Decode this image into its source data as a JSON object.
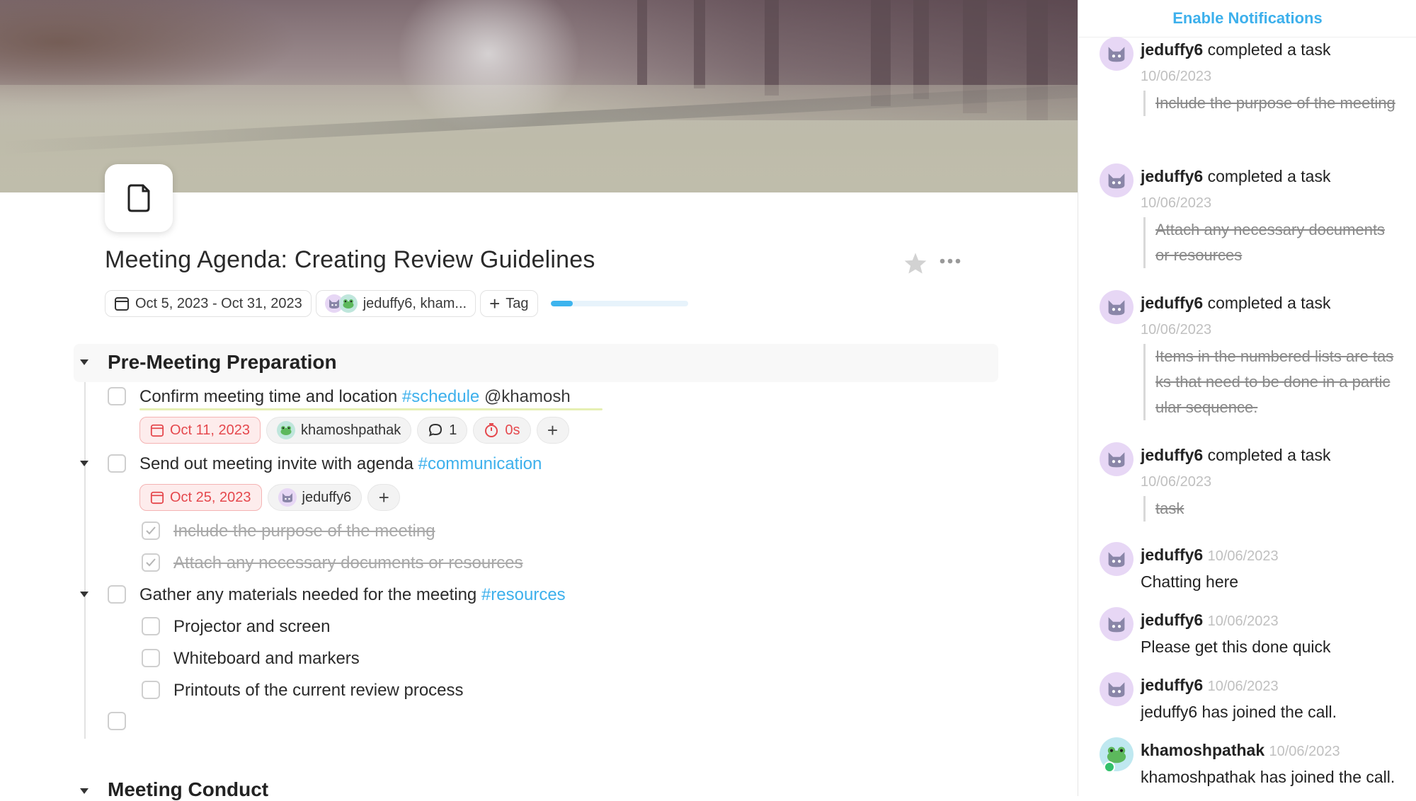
{
  "page": {
    "title": "Meeting Agenda: Creating Review Guidelines",
    "date_range": "Oct 5, 2023 - Oct 31, 2023",
    "assignees_label": "jeduffy6, kham...",
    "tag_button": "Tag",
    "progress_percent": 16
  },
  "sections": [
    {
      "title": "Pre-Meeting Preparation"
    },
    {
      "title": "Meeting Conduct"
    }
  ],
  "tasks": {
    "t1": {
      "text": "Confirm meeting time and location",
      "tag": "#schedule",
      "mention": "@khamosh",
      "due": "Oct 11, 2023",
      "assignee": "khamoshpathak",
      "comments": "1",
      "timer": "0s"
    },
    "t2": {
      "text": "Send out meeting invite with agenda",
      "tag": "#communication",
      "due": "Oct 25, 2023",
      "assignee": "jeduffy6",
      "subtasks": [
        "Include the purpose of the meeting",
        "Attach any necessary documents or resources"
      ]
    },
    "t3": {
      "text": "Gather any materials needed for the meeting",
      "tag": "#resources",
      "subtasks": [
        "Projector and screen",
        "Whiteboard and markers",
        "Printouts of the current review process"
      ]
    }
  },
  "panel": {
    "enable_notifications": "Enable Notifications",
    "activity": [
      {
        "user": "jeduffy6",
        "action": "completed a",
        "action2": "task",
        "time": "10/06/2023",
        "quote": "Include the purpose of the meeting"
      },
      {
        "user": "jeduffy6",
        "action": "completed a",
        "action2": "task",
        "time": "10/06/2023",
        "quote": "Attach any necessary documents or resources"
      },
      {
        "user": "jeduffy6",
        "action": "completed a",
        "action2": "task",
        "time": "10/06/2023",
        "quote": "Items in the numbered lists are tasks that need to be done in a particular sequence."
      },
      {
        "user": "jeduffy6",
        "action": "completed a",
        "action2": "task",
        "time": "10/06/2023",
        "quote": "task"
      },
      {
        "user": "jeduffy6",
        "time": "10/06/2023",
        "message": "Chatting here"
      },
      {
        "user": "jeduffy6",
        "time": "10/06/2023",
        "message": "Please get this done quick"
      },
      {
        "user": "jeduffy6",
        "time": "10/06/2023",
        "message": "jeduffy6 has joined the call."
      },
      {
        "user": "khamoshpathak",
        "time": "10/06/2023",
        "message": "khamoshpathak has joined the call."
      }
    ]
  },
  "icons": {
    "page": "blank-page-icon",
    "calendar": "calendar-icon",
    "comment": "comment-icon",
    "timer": "timer-icon",
    "cat_avatar": "cat-avatar-icon",
    "frog_avatar": "frog-avatar-icon"
  },
  "colors": {
    "accent": "#3db0ec",
    "overdue": "#e5484d",
    "done_text": "#a9a9a9"
  }
}
